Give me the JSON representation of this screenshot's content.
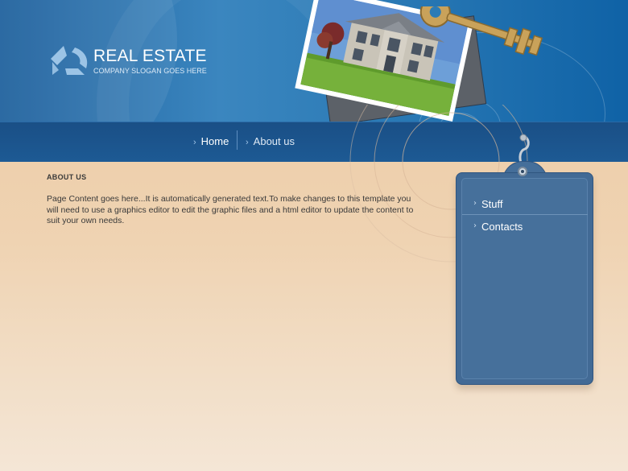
{
  "brand": {
    "title": "REAL ESTATE",
    "slogan": "COMPANY SLOGAN GOES HERE"
  },
  "nav": {
    "items": [
      {
        "label": "Home"
      },
      {
        "label": "About us"
      }
    ]
  },
  "content": {
    "heading": "ABOUT US",
    "text": "Page Content goes here...It is automatically generated text.To make changes to this template you will need to use a graphics editor to edit the graphic files and a html editor to update the content to suit your own needs."
  },
  "sidebar": {
    "items": [
      {
        "label": "Stuff"
      },
      {
        "label": "Contacts"
      }
    ]
  },
  "colors": {
    "header_blue": "#2c7bb6",
    "nav_blue": "#1d5a94",
    "panel_blue": "#426a95",
    "page_peach": "#efd3b2"
  },
  "icons": [
    "logo-mark-icon",
    "chevron-right-icon",
    "house-photo",
    "key-icon",
    "hook-icon"
  ]
}
